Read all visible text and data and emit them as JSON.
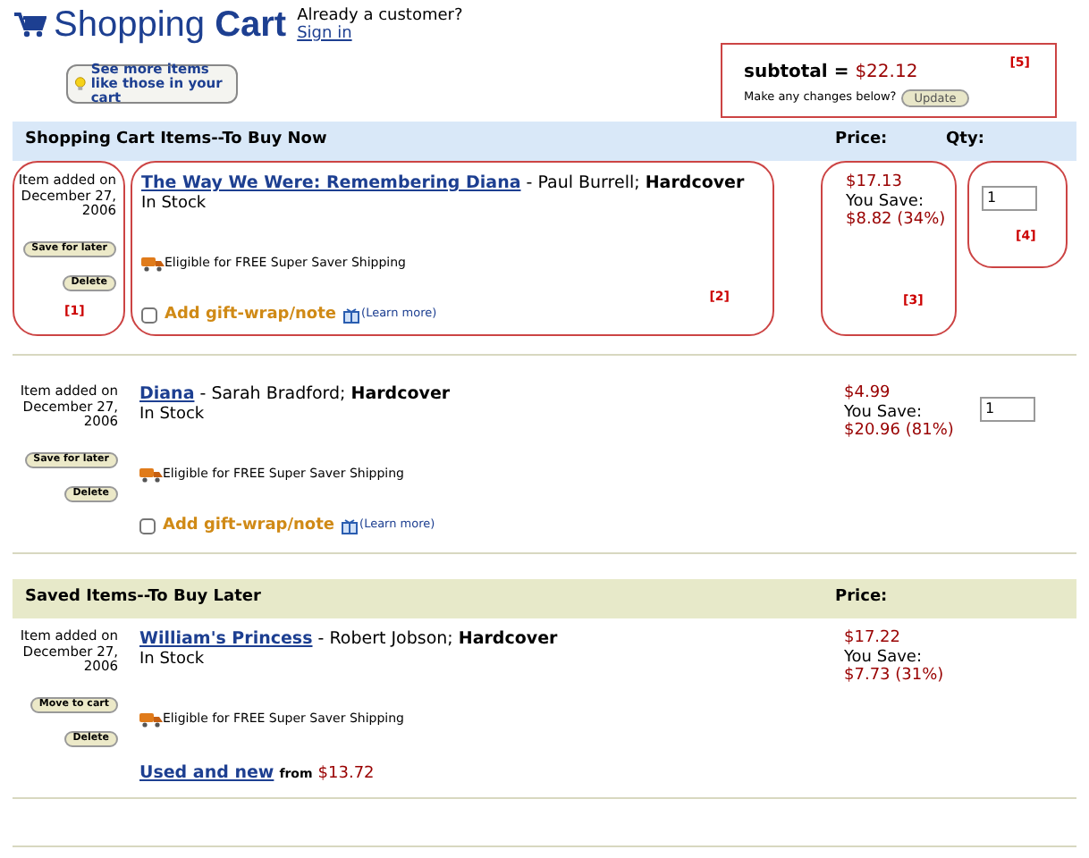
{
  "header": {
    "title_light": "Shopping",
    "title_bold": "Cart",
    "customer_prompt": "Already a customer?",
    "sign_in": "Sign in",
    "see_more": "See more items like those in your cart"
  },
  "subtotal": {
    "label": "subtotal =",
    "amount": "$22.12",
    "prompt": "Make any changes below?",
    "button": "Update",
    "note": "[5]"
  },
  "cart": {
    "heading": "Shopping Cart Items--To Buy Now",
    "price_heading": "Price:",
    "qty_heading": "Qty:",
    "items": [
      {
        "added": "Item added on December 27, 2006",
        "buttons": [
          "Save for later",
          "Delete"
        ],
        "title": "The Way We Were: Remembering Diana",
        "author": "- Paul Burrell;",
        "format": "Hardcover",
        "stock": "In Stock",
        "shipping": "Eligible for FREE Super Saver Shipping",
        "gift": "Add gift-wrap/note",
        "gift_checked": false,
        "learn_more": "(Learn more)",
        "price": "$17.13",
        "you_save": "You Save:",
        "savings": "$8.82 (34%)",
        "qty": "1",
        "notes": {
          "actions": "[1]",
          "details": "[2]",
          "price": "[3]",
          "qty": "[4]"
        }
      },
      {
        "added": "Item added on December 27, 2006",
        "buttons": [
          "Save for later",
          "Delete"
        ],
        "title": "Diana",
        "author": "- Sarah Bradford;",
        "format": "Hardcover",
        "stock": "In Stock",
        "shipping": "Eligible for FREE Super Saver Shipping",
        "gift": "Add gift-wrap/note",
        "gift_checked": false,
        "learn_more": "(Learn more)",
        "price": "$4.99",
        "you_save": "You Save:",
        "savings": "$20.96 (81%)",
        "qty": "1"
      }
    ]
  },
  "saved": {
    "heading": "Saved Items--To Buy Later",
    "price_heading": "Price:",
    "items": [
      {
        "added": "Item added on December 27, 2006",
        "buttons": [
          "Move to cart",
          "Delete"
        ],
        "title": "William's Princess",
        "author": "- Robert Jobson;",
        "format": "Hardcover",
        "stock": "In Stock",
        "shipping": "Eligible for FREE Super Saver Shipping",
        "used_new": "Used and new",
        "from": "from",
        "used_price": "$13.72",
        "price": "$17.22",
        "you_save": "You Save:",
        "savings": "$7.73 (31%)"
      }
    ]
  }
}
